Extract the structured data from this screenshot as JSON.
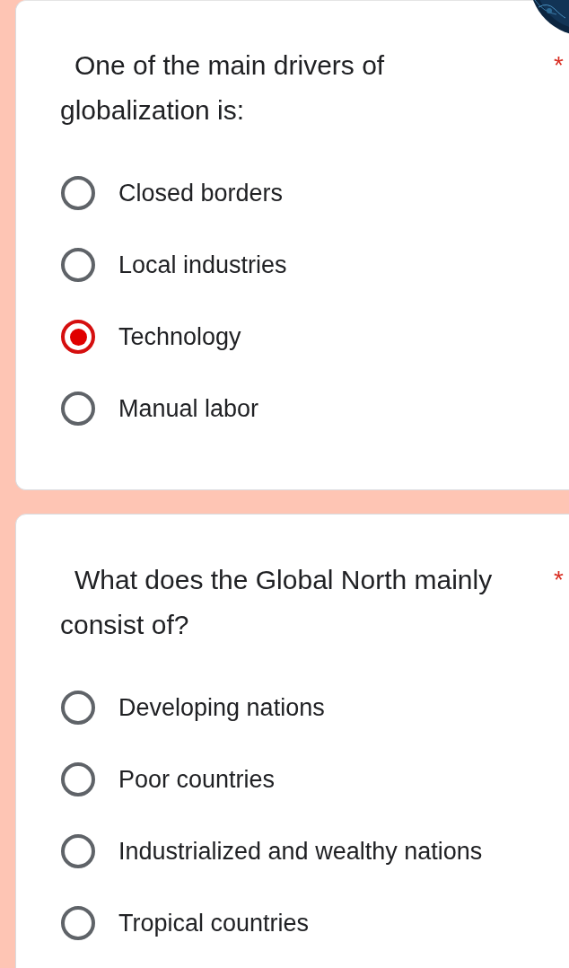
{
  "questions": [
    {
      "text": "One of the main drivers of globalization is:",
      "required_mark": "*",
      "options": [
        {
          "label": "Closed borders",
          "selected": false
        },
        {
          "label": "Local industries",
          "selected": false
        },
        {
          "label": "Technology",
          "selected": true
        },
        {
          "label": "Manual labor",
          "selected": false
        }
      ]
    },
    {
      "text": "What does the Global North mainly consist of?",
      "required_mark": "*",
      "options": [
        {
          "label": "Developing nations",
          "selected": false
        },
        {
          "label": "Poor countries",
          "selected": false
        },
        {
          "label": "Industrialized and wealthy nations",
          "selected": false
        },
        {
          "label": "Tropical countries",
          "selected": false
        }
      ]
    }
  ]
}
